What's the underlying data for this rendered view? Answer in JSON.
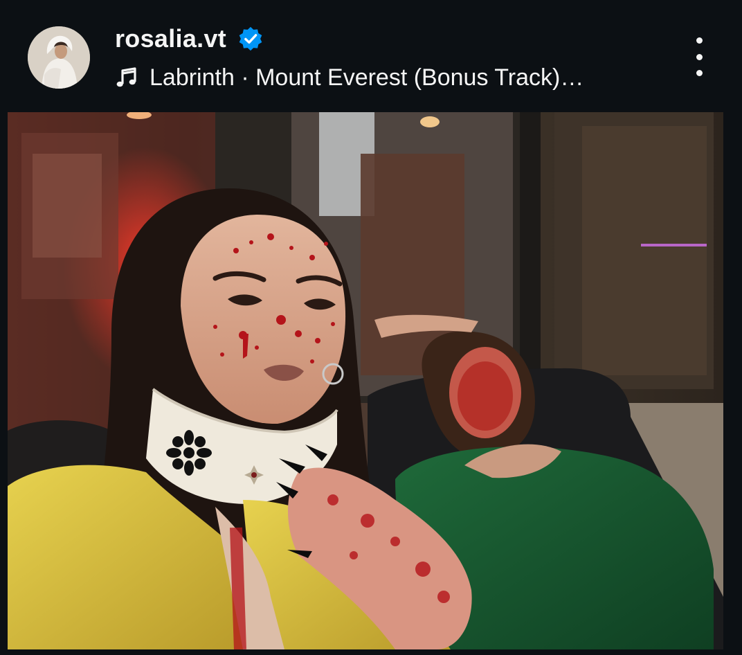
{
  "post": {
    "username": "rosalia.vt",
    "verified": true,
    "audio": {
      "icon": "music-note-icon",
      "text": "Labrinth · Mount Everest (Bonus Track)…"
    },
    "more_icon": "more-vertical-icon"
  },
  "colors": {
    "background": "#0c1014",
    "text": "#f5f5f5",
    "verified_blue": "#0095f6"
  }
}
